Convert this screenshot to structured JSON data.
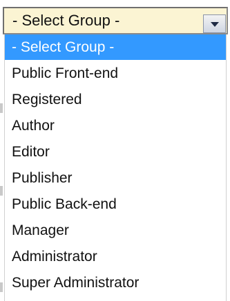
{
  "select": {
    "value": "- Select Group -",
    "arrow_icon": "chevron-down-icon"
  },
  "options": [
    "- Select Group -",
    "Public Front-end",
    "Registered",
    "Author",
    "Editor",
    "Publisher",
    "Public Back-end",
    "Manager",
    "Administrator",
    "Super Administrator"
  ],
  "colors": {
    "selected_bg": "#3399ff",
    "select_bg": "#fbf4d3"
  }
}
